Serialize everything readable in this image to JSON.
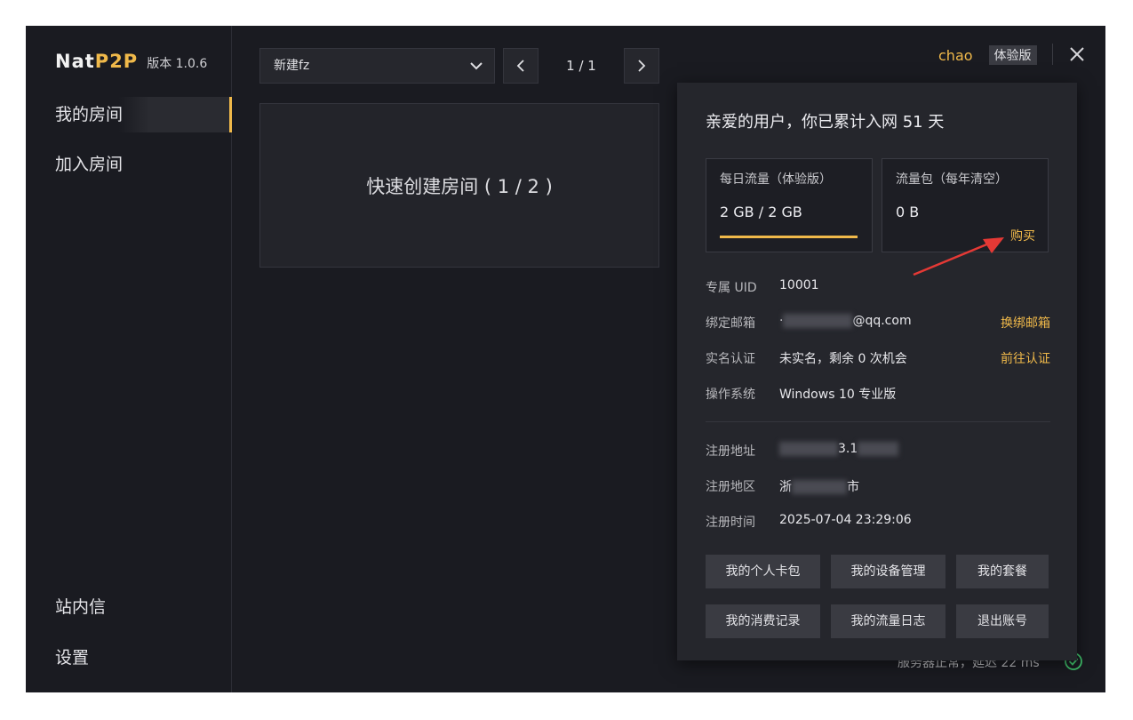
{
  "app": {
    "brand_nat": "Nat",
    "brand_p2p": "P2P",
    "version": "版本 1.0.6"
  },
  "sidebar": {
    "items": [
      {
        "label": "我的房间",
        "active": true
      },
      {
        "label": "加入房间",
        "active": false
      }
    ],
    "bottom": [
      {
        "label": "站内信"
      },
      {
        "label": "设置"
      }
    ]
  },
  "main": {
    "room_select": "新建fz",
    "pager": "1 / 1",
    "quick_create": "快速创建房间 ( 1 / 2 )",
    "status_text": "服务器正常，延迟 22 ms"
  },
  "header": {
    "username": "chao",
    "plan": "体验版"
  },
  "panel": {
    "greeting": "亲爱的用户，你已累计入网 51 天",
    "daily": {
      "label": "每日流量（体验版）",
      "value": "2 GB / 2 GB",
      "usage_fraction": 1.0
    },
    "package": {
      "label": "流量包（每年清空）",
      "value": "0 B",
      "buy": "购买"
    },
    "uid": {
      "key": "专属 UID",
      "value": "10001"
    },
    "email": {
      "key": "绑定邮箱",
      "value_prefix": "·",
      "value_suffix": "@qq.com",
      "action": "换绑邮箱"
    },
    "realname": {
      "key": "实名认证",
      "value": "未实名，剩余 0 次机会",
      "action": "前往认证"
    },
    "os": {
      "key": "操作系统",
      "value": "Windows 10 专业版"
    },
    "reg_addr": {
      "key": "注册地址",
      "value_suffix": "3.1"
    },
    "reg_region": {
      "key": "注册地区",
      "value_prefix": "浙",
      "value_suffix": "市"
    },
    "reg_time": {
      "key": "注册时间",
      "value": "2025-07-04 23:29:06"
    },
    "buttons": [
      "我的个人卡包",
      "我的设备管理",
      "我的套餐",
      "我的消费记录",
      "我的流量日志",
      "退出账号"
    ]
  },
  "colors": {
    "accent": "#f0b94a",
    "background": "#1a1b21",
    "panel": "#25262c",
    "status_ok": "#3fbf6a",
    "arrow": "#e53935"
  }
}
